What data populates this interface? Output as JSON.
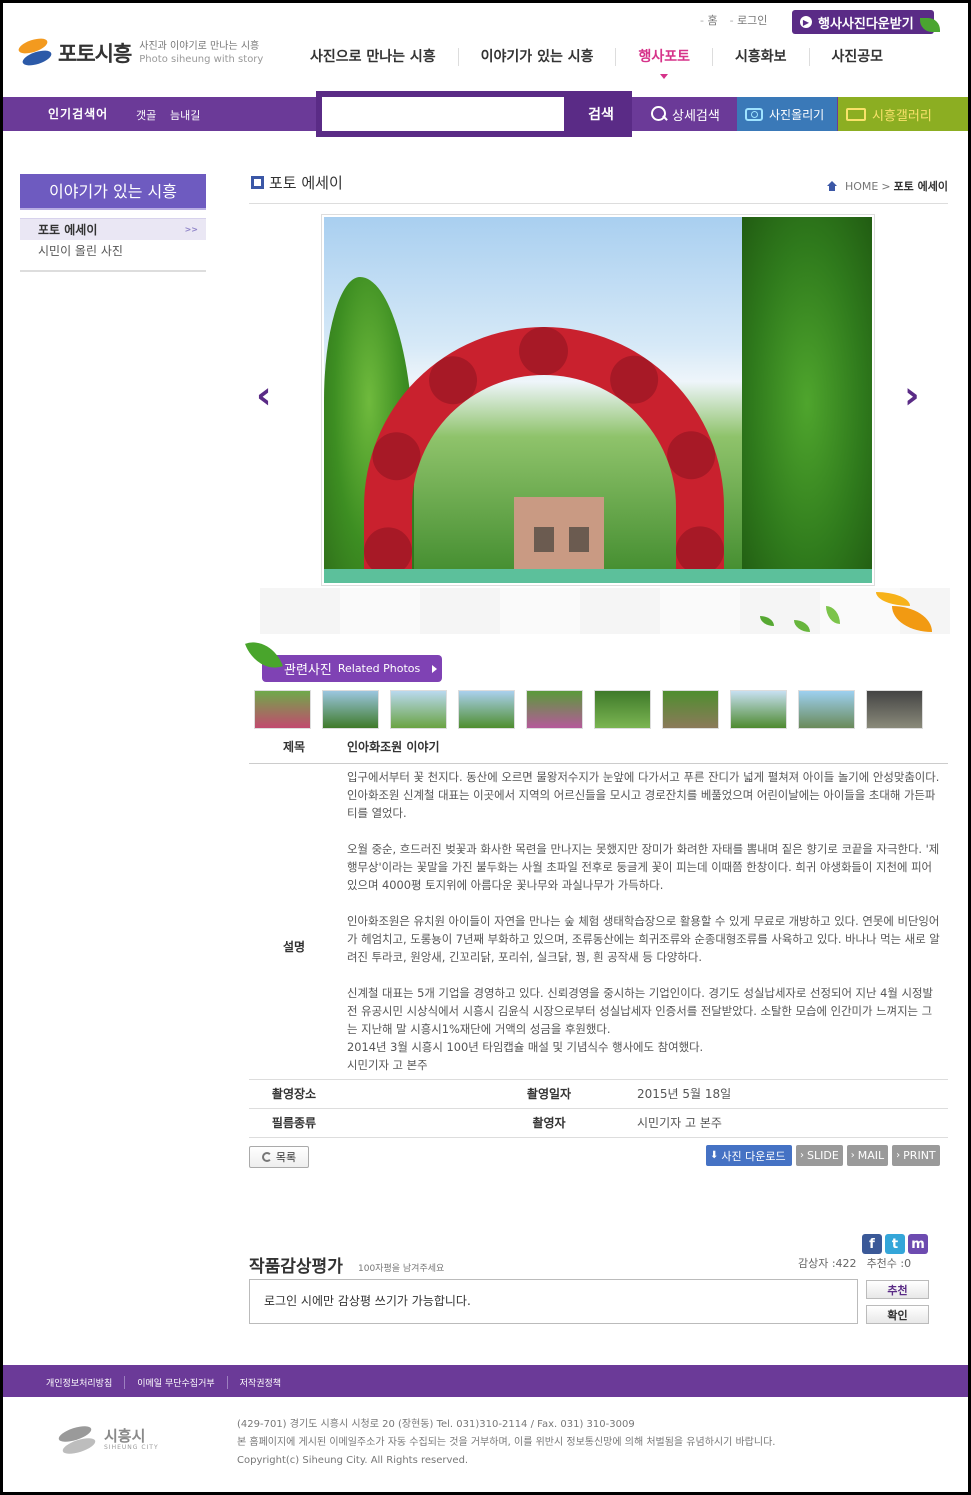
{
  "header": {
    "site_title": "포토시흥",
    "tagline_ko": "사진과 이야기로 만나는 시흥",
    "tagline_en": "Photo siheung with story",
    "top_links": [
      "홈",
      "로그인"
    ],
    "download_button": "행사사진다운받기",
    "nav": [
      "사진으로 만나는 시흥",
      "이야기가 있는 시흥",
      "행사포토",
      "시흥화보",
      "사진공모"
    ],
    "nav_active_index": 2
  },
  "search_bar": {
    "popular_label": "인기검색어",
    "popular_keywords": [
      "갯골",
      "늠내길"
    ],
    "input_value": "",
    "search_button": "검색",
    "advanced_search": "상세검색",
    "upload_button": "사진올리기",
    "gallery_button": "시흥갤러리"
  },
  "sidebar": {
    "title": "이야기가 있는 시흥",
    "items": [
      {
        "label": "포토 에세이",
        "active": true
      },
      {
        "label": "시민이 올린 사진",
        "active": false
      }
    ]
  },
  "content": {
    "page_title": "포토 에세이",
    "breadcrumb_home": "HOME",
    "breadcrumb_current": "포토 에세이",
    "prev_arrow": "‹",
    "next_arrow": "›",
    "related_ko": "관련사진",
    "related_en": "Related Photos",
    "thumb_count": 10,
    "subject_label": "제목",
    "subject": "인아화조원 이야기",
    "desc_label": "설명",
    "paragraphs": [
      "입구에서부터 꽃 천지다. 동산에 오르면 물왕저수지가 눈앞에 다가서고 푸른 잔디가 넓게 펼쳐져 아이들 놀기에 안성맞춤이다. 인아화조원 신계철 대표는 이곳에서 지역의 어르신들을 모시고 경로잔치를 베풀었으며 어린이날에는 아이들을 초대해 가든파티를 열었다.",
      "오월 중순, 흐드러진 벚꽃과 화사한 목련을 만나지는 못했지만 장미가 화려한 자태를 뽐내며 짙은 향기로 코끝을 자극한다. '제행무상'이라는 꽃말을 가진 불두화는 사월 초파일 전후로 둥글게 꽃이 피는데 이때쯤 한창이다. 희귀 야생화들이 지천에 피어있으며 4000평 토지위에 아름다운 꽃나무와 과실나무가 가득하다.",
      "인아화조원은 유치원 아이들이 자연을 만나는 숲 체험 생태학습장으로 활용할 수 있게 무료로 개방하고 있다. 연못에 비단잉어가 헤엄치고, 도롱뇽이 7년째 부화하고 있으며, 조류동산에는 희귀조류와 순종대형조류를 사육하고 있다. 바나나 먹는 새로 알려진 투라코, 원앙새, 긴꼬리닭, 포리쉬, 실크닭, 꿩, 흰 공작새 등 다양하다."
    ],
    "last_paragraph_lines": [
      "신계철 대표는 5개 기업을 경영하고 있다. 신뢰경영을 중시하는 기업인이다. 경기도 성실납세자로 선정되어 지난 4월 시정발전 유공시민 시상식에서 시흥시 김윤식 시장으로부터 성실납세자 인증서를 전달받았다. 소탈한 모습에 인간미가 느껴지는 그는 지난해 말 시흥시1%재단에 거액의 성금을 후원했다.",
      "2014년 3월 시흥시 100년 타임캡슐 매설 및 기념식수 행사에도 참여했다.",
      "시민기자 고 본주"
    ],
    "place_label": "촬영장소",
    "place_value": "",
    "date_label": "촬영일자",
    "date_value": "2015년 5월 18일",
    "film_label": "필름종류",
    "film_value": "",
    "photographer_label": "촬영자",
    "photographer_value": "시민기자 고 본주",
    "list_button": "목록",
    "actions": [
      "사진 다운로드",
      "SLIDE",
      "MAIL",
      "PRINT"
    ]
  },
  "review": {
    "title": "작품감상평가",
    "note": "100자평을 남겨주세요",
    "views_label": "감상자 :422",
    "recommend_label": "추천수 :0",
    "login_notice": "로그인 시에만 감상평 쓰기가 가능합니다.",
    "recommend_button": "추천",
    "confirm_button": "확인",
    "sns": [
      "f",
      "t",
      "m"
    ]
  },
  "footer": {
    "links": [
      "개인정보처리방침",
      "이메일 무단수집거부",
      "저작권정책"
    ],
    "logo_name": "시흥시",
    "logo_en": "SIHEUNG CITY",
    "address": "(429-701) 경기도 시흥시 시청로 20 (장현동) Tel. 031)310-2114 / Fax. 031) 310-3009",
    "email_notice": "본 홈페이지에 게시된 이메일주소가 자동 수집되는 것을 거부하며, 이를 위반시 정보통신망에 의해 처벌됨을 유념하시기 바랍니다.",
    "copyright": "Copyright(c) Siheung City. All Rights reserved."
  },
  "colors": {
    "brand_purple": "#6b3a98",
    "active_pink": "#d6338a",
    "sidebar_blue": "#6e5bc0"
  }
}
